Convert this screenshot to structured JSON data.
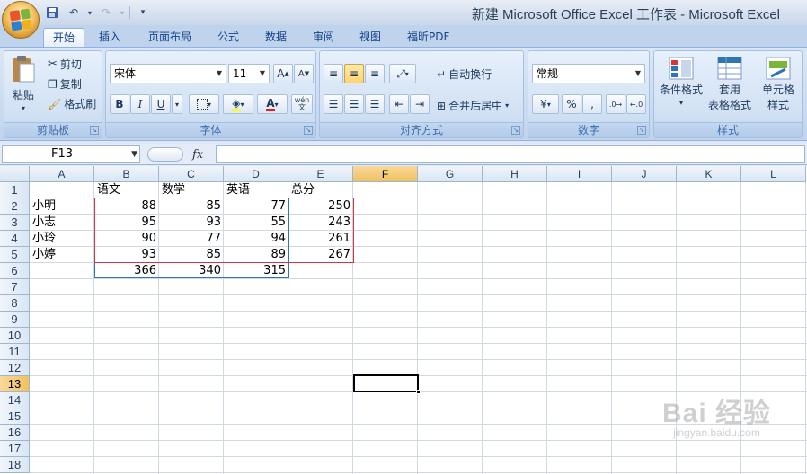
{
  "window": {
    "title": "新建 Microsoft Office Excel 工作表 - Microsoft Excel"
  },
  "tabs": [
    "开始",
    "插入",
    "页面布局",
    "公式",
    "数据",
    "审阅",
    "视图",
    "福昕PDF"
  ],
  "ribbon": {
    "clipboard": {
      "label": "剪贴板",
      "paste": "粘贴",
      "cut": "剪切",
      "copy": "复制",
      "format_painter": "格式刷"
    },
    "font": {
      "label": "字体",
      "font_name": "宋体",
      "font_size": "11",
      "bold": "B",
      "italic": "I",
      "underline": "U",
      "grow": "A",
      "shrink": "A",
      "phonetic": "wén\n文"
    },
    "alignment": {
      "label": "对齐方式",
      "wrap_text": "自动换行",
      "merge_center": "合并后居中"
    },
    "number": {
      "label": "数字",
      "format": "常规",
      "percent": "%",
      "comma": ","
    },
    "styles": {
      "label": "样式",
      "conditional": "条件格式",
      "table_format_1": "套用",
      "table_format_2": "表格格式",
      "cell_styles_1": "单元格",
      "cell_styles_2": "样式"
    }
  },
  "formula_bar": {
    "name_box": "F13",
    "fx": "fx",
    "formula": ""
  },
  "columns": [
    "A",
    "B",
    "C",
    "D",
    "E",
    "F",
    "G",
    "H",
    "I",
    "J",
    "K",
    "L"
  ],
  "rows": [
    "1",
    "2",
    "3",
    "4",
    "5",
    "6",
    "7",
    "8",
    "9",
    "10",
    "11",
    "12",
    "13",
    "14",
    "15",
    "16",
    "17",
    "18"
  ],
  "selected_cell": {
    "column": "F",
    "row": "13"
  },
  "sheet": {
    "headers": {
      "B1": "语文",
      "C1": "数学",
      "D1": "英语",
      "E1": "总分"
    },
    "names": [
      "小明",
      "小志",
      "小玲",
      "小婷"
    ],
    "scores": [
      {
        "b": 88,
        "c": 85,
        "d": 77,
        "e": 250
      },
      {
        "b": 95,
        "c": 93,
        "d": 55,
        "e": 243
      },
      {
        "b": 90,
        "c": 77,
        "d": 94,
        "e": 261
      },
      {
        "b": 93,
        "c": 85,
        "d": 89,
        "e": 267
      }
    ],
    "totals": {
      "b": 366,
      "c": 340,
      "d": 315
    }
  },
  "watermark": {
    "main": "Bai 经验",
    "sub": "jingyan.baidu.com"
  },
  "colors": {
    "blue_border": "#2e75b6",
    "red_border": "#d9343a",
    "selected_header": "#f1c15f"
  }
}
